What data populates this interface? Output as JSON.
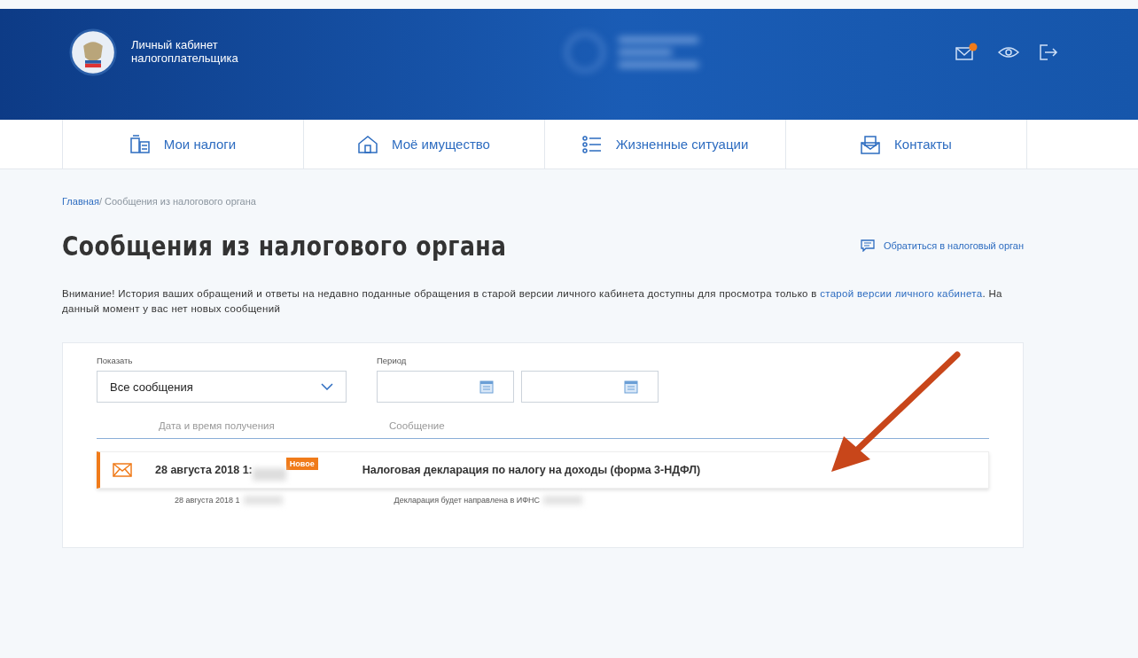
{
  "header": {
    "title": "Личный кабинет налогоплательщика"
  },
  "nav": [
    {
      "label": "Мои налоги",
      "selected": false
    },
    {
      "label": "Моё имущество",
      "selected": false
    },
    {
      "label": "Жизненные ситуации",
      "selected": false
    },
    {
      "label": "Контакты",
      "selected": false
    }
  ],
  "breadcrumb": {
    "home": "Главная",
    "current": "/ Сообщения из налогового органа"
  },
  "page_title": "Сообщения из налогового органа",
  "contact_link": "Обратиться в налоговый орган",
  "notice": {
    "text": "Внимание! История ваших обращений и ответы на недавно поданные обращения в старой версии личного кабинета доступны для просмотра только в",
    "link": "старой версии личного кабинета",
    "after": ". На данный момент у вас нет новых сообщений"
  },
  "filters": {
    "show_label": "Показать",
    "show_value": "Все сообщения",
    "period_label": "Период"
  },
  "table": {
    "columns": [
      "Дата и время получения",
      "Сообщение"
    ],
    "rows": [
      {
        "unread": true,
        "date": "28 августа 2018 1:",
        "badge": "Новое",
        "message": "Налоговая декларация по налогу на доходы (форма 3-НДФЛ)",
        "sub_date": "28 августа 2018 1",
        "sub_message": "Декларация будет направлена в ИФНС"
      }
    ]
  }
}
